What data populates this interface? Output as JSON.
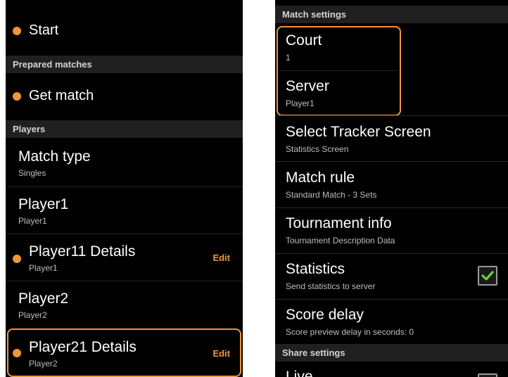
{
  "left": {
    "start_label": "Start",
    "prepared_header": "Prepared matches",
    "get_match_label": "Get match",
    "players_header": "Players",
    "match_type": {
      "title": "Match type",
      "value": "Singles"
    },
    "player1": {
      "title": "Player1",
      "value": "Player1"
    },
    "player11_details": {
      "title": "Player11 Details",
      "value": "Player1",
      "action": "Edit"
    },
    "player2": {
      "title": "Player2",
      "value": "Player2"
    },
    "player21_details": {
      "title": "Player21 Details",
      "value": "Player2",
      "action": "Edit"
    }
  },
  "right": {
    "match_settings_header": "Match settings",
    "court": {
      "title": "Court",
      "value": "1"
    },
    "server": {
      "title": "Server",
      "value": "Player1"
    },
    "tracker": {
      "title": "Select Tracker Screen",
      "value": "Statistics Screen"
    },
    "match_rule": {
      "title": "Match rule",
      "value": "Standard Match - 3 Sets"
    },
    "tournament": {
      "title": "Tournament info",
      "value": "Tournament Description Data"
    },
    "statistics": {
      "title": "Statistics",
      "value": "Send statistics to server",
      "checked": true
    },
    "score_delay": {
      "title": "Score delay",
      "value": "Score preview delay in seconds: 0"
    },
    "share_header": "Share settings",
    "live": {
      "title": "Live"
    }
  },
  "colors": {
    "accent": "#f0953a",
    "check": "#6bd12c",
    "background": "#000000"
  }
}
